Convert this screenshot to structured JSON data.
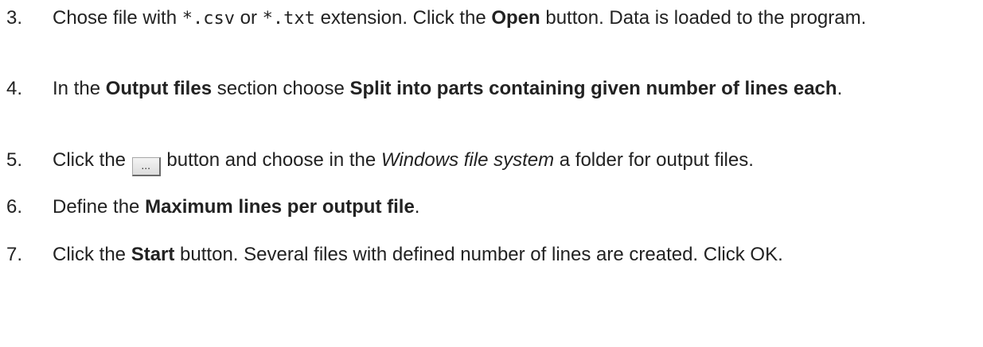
{
  "steps": [
    {
      "number": "3.",
      "parts": [
        "Chose file with ",
        "*.csv",
        " or ",
        "*.txt",
        " extension. Click the ",
        "Open",
        " button. Data is loaded to the program."
      ]
    },
    {
      "number": "4.",
      "parts": [
        "In the ",
        "Output files",
        " section choose ",
        "Split into parts containing given number of lines each",
        "."
      ]
    },
    {
      "number": "5.",
      "parts": [
        "Click the ",
        "...",
        " button and choose in the ",
        "Windows file system",
        " a folder for output files."
      ]
    },
    {
      "number": "6.",
      "parts": [
        "Define the ",
        "Maximum lines per output file",
        "."
      ]
    },
    {
      "number": "7.",
      "parts": [
        "Click the ",
        "Start",
        " button. Several files with defined number of lines are created. Click OK."
      ]
    }
  ]
}
